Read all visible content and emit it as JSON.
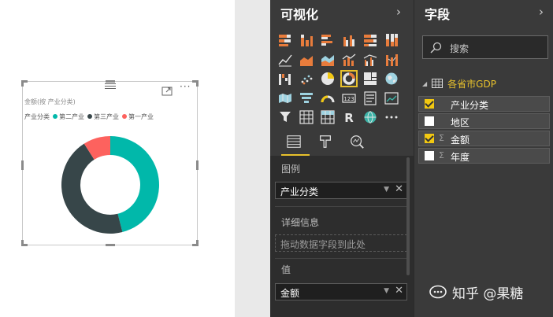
{
  "canvas": {
    "chart_title": "金额(按 产业分类)",
    "legend_title": "产业分类",
    "legend": [
      {
        "label": "第二产业",
        "color": "#01b8aa"
      },
      {
        "label": "第三产业",
        "color": "#374649"
      },
      {
        "label": "第一产业",
        "color": "#fd625e"
      }
    ],
    "more_label": "···"
  },
  "chart_data": {
    "type": "pie",
    "title": "金额(按 产业分类)",
    "legend_title": "产业分类",
    "categories": [
      "第二产业",
      "第三产业",
      "第一产业"
    ],
    "values": [
      46,
      45,
      9
    ],
    "colors": [
      "#01b8aa",
      "#374649",
      "#fd625e"
    ],
    "legend_position": "top-left"
  },
  "viz_pane": {
    "title": "可视化",
    "chevron": "›",
    "icons": [
      "stacked-bar-icon",
      "stacked-column-icon",
      "clustered-bar-icon",
      "clustered-column-icon",
      "100-bar-icon",
      "100-column-icon",
      "line-chart-icon",
      "area-chart-icon",
      "stacked-area-icon",
      "line-column-icon",
      "line-column-2-icon",
      "ribbon-chart-icon",
      "waterfall-icon",
      "scatter-icon",
      "pie-chart-icon",
      "donut-chart-icon",
      "treemap-icon",
      "map-icon",
      "filled-map-icon",
      "funnel-icon",
      "gauge-icon",
      "card-icon",
      "multirow-card-icon",
      "kpi-icon",
      "slicer-icon",
      "table-icon",
      "matrix-icon",
      "r-visual-icon",
      "globe-icon",
      "more-visuals-icon"
    ],
    "selected_icon": "donut-chart-icon",
    "tabs": [
      "fields-tab-icon",
      "format-tab-icon",
      "analytics-tab-icon"
    ],
    "wells": {
      "legend_label": "图例",
      "legend_value": "产业分类",
      "details_label": "详细信息",
      "details_placeholder": "拖动数据字段到此处",
      "values_label": "值",
      "values_value": "金额"
    }
  },
  "fields_pane": {
    "title": "字段",
    "chevron": "›",
    "search_placeholder": "搜索",
    "table_name": "各省市GDP",
    "fields": [
      {
        "name": "产业分类",
        "checked": true,
        "sigma": false
      },
      {
        "name": "地区",
        "checked": false,
        "sigma": false
      },
      {
        "name": "金额",
        "checked": true,
        "sigma": true
      },
      {
        "name": "年度",
        "checked": false,
        "sigma": true
      }
    ],
    "sigma_symbol": "Σ"
  },
  "watermark": "知乎 @果糖"
}
